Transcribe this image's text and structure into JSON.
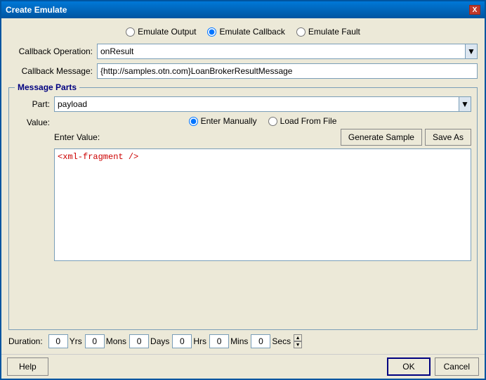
{
  "dialog": {
    "title": "Create Emulate",
    "close_label": "X"
  },
  "emulate_type": {
    "options": [
      {
        "id": "emulate-output",
        "label": "Emulate Output",
        "checked": false
      },
      {
        "id": "emulate-callback",
        "label": "Emulate Callback",
        "checked": true
      },
      {
        "id": "emulate-fault",
        "label": "Emulate Fault",
        "checked": false
      }
    ]
  },
  "callback_operation": {
    "label": "Callback Operation:",
    "value": "onResult"
  },
  "callback_message": {
    "label": "Callback Message:",
    "value": "{http://samples.otn.com}LoanBrokerResultMessage"
  },
  "message_parts": {
    "title": "Message Parts",
    "part_label": "Part:",
    "part_value": "payload",
    "value_label": "Value:",
    "enter_manually_label": "Enter Manually",
    "load_from_file_label": "Load From File",
    "enter_value_label": "Enter Value:",
    "generate_sample_label": "Generate Sample",
    "save_as_label": "Save As",
    "xml_content": "<xml-fragment />"
  },
  "duration": {
    "label": "Duration:",
    "fields": [
      {
        "value": "0",
        "unit": "Yrs"
      },
      {
        "value": "0",
        "unit": "Mons"
      },
      {
        "value": "0",
        "unit": "Days"
      },
      {
        "value": "0",
        "unit": "Hrs"
      },
      {
        "value": "0",
        "unit": "Mins"
      },
      {
        "value": "0",
        "unit": "Secs"
      }
    ]
  },
  "buttons": {
    "help": "Help",
    "ok": "OK",
    "cancel": "Cancel"
  }
}
